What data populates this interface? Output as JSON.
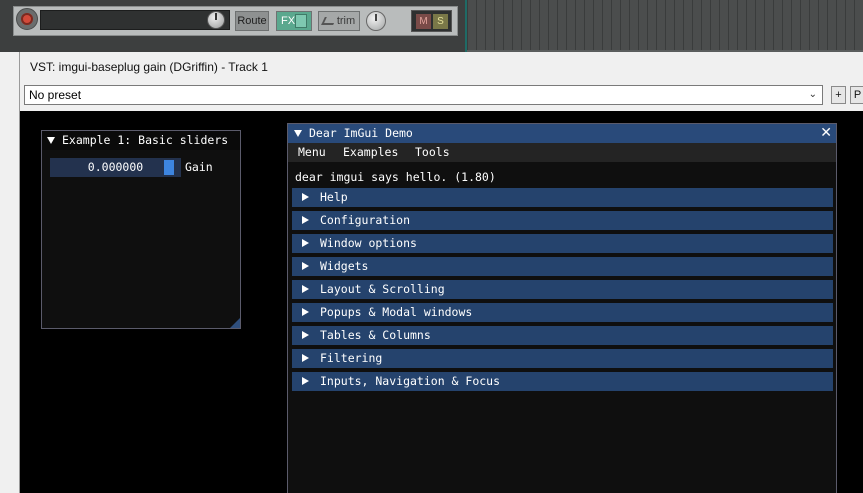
{
  "track": {
    "route_label": "Route",
    "fx_label": "FX",
    "trim_label": "trim",
    "mute_label": "M",
    "solo_label": "S"
  },
  "plugin_window": {
    "title": "VST: imgui-baseplug gain (DGriffin) - Track 1",
    "preset": "No preset",
    "add_label": "+",
    "p_label": "P"
  },
  "example_window": {
    "title": "Example 1: Basic sliders",
    "gain_value": "0.000000",
    "gain_label": "Gain"
  },
  "demo_window": {
    "title": "Dear ImGui Demo",
    "close_glyph": "✕",
    "menu": [
      "Menu",
      "Examples",
      "Tools"
    ],
    "hello": "dear imgui says hello. (1.80)",
    "headers": [
      "Help",
      "Configuration",
      "Window options",
      "Widgets",
      "Layout & Scrolling",
      "Popups & Modal windows",
      "Tables & Columns",
      "Filtering",
      "Inputs, Navigation & Focus"
    ]
  },
  "colors": {
    "imgui_title_active": "#294a7a",
    "imgui_header": "#25436d",
    "imgui_slider_grab": "#3d85e0",
    "fx_button": "#5aa88e"
  }
}
